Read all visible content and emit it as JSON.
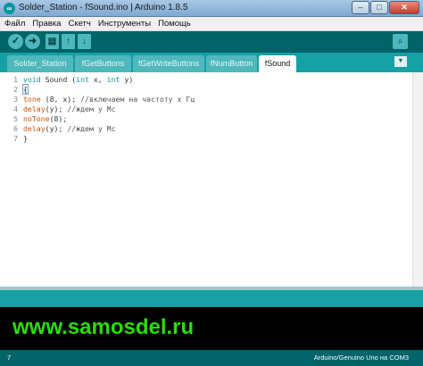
{
  "window": {
    "title": "Solder_Station - fSound.ino | Arduino 1.8.5",
    "app_icon_glyph": "∞",
    "minimize_glyph": "–",
    "maximize_glyph": "□",
    "close_glyph": "✕"
  },
  "menu": [
    "Файл",
    "Правка",
    "Скетч",
    "Инструменты",
    "Помощь"
  ],
  "toolbar": {
    "verify_glyph": "✓",
    "upload_glyph": "➜",
    "new_glyph": "▤",
    "open_glyph": "↑",
    "save_glyph": "↓",
    "serial_monitor_glyph": "⌕"
  },
  "tabs": [
    {
      "label": "Solder_Station",
      "active": false
    },
    {
      "label": "fGetButtons",
      "active": false
    },
    {
      "label": "fGetWriteButtons",
      "active": false
    },
    {
      "label": "fNumButton",
      "active": false
    },
    {
      "label": "fSound",
      "active": true
    }
  ],
  "tab_menu_glyph": "▼",
  "code_lines": [
    {
      "number": "1",
      "text": "void Sound (int x, int y)"
    },
    {
      "number": "2",
      "text": "{"
    },
    {
      "number": "3",
      "text": "tone (8, x); //включаем на частоту x Гц"
    },
    {
      "number": "4",
      "text": "delay(y); //ждем y Мс"
    },
    {
      "number": "5",
      "text": "noTone(8);"
    },
    {
      "number": "6",
      "text": "delay(y); //ждем y Мс"
    },
    {
      "number": "7",
      "text": "}"
    }
  ],
  "watermark": "www.samosdel.ru",
  "status": {
    "line_number": "7",
    "board": "Arduino/Genuino Uno на COM3"
  },
  "colors": {
    "toolbar": "#006468",
    "tabbar": "#17a1a5",
    "keyword_orange": "#d35400",
    "keyword_blue": "#00979c",
    "watermark": "#27e000"
  }
}
